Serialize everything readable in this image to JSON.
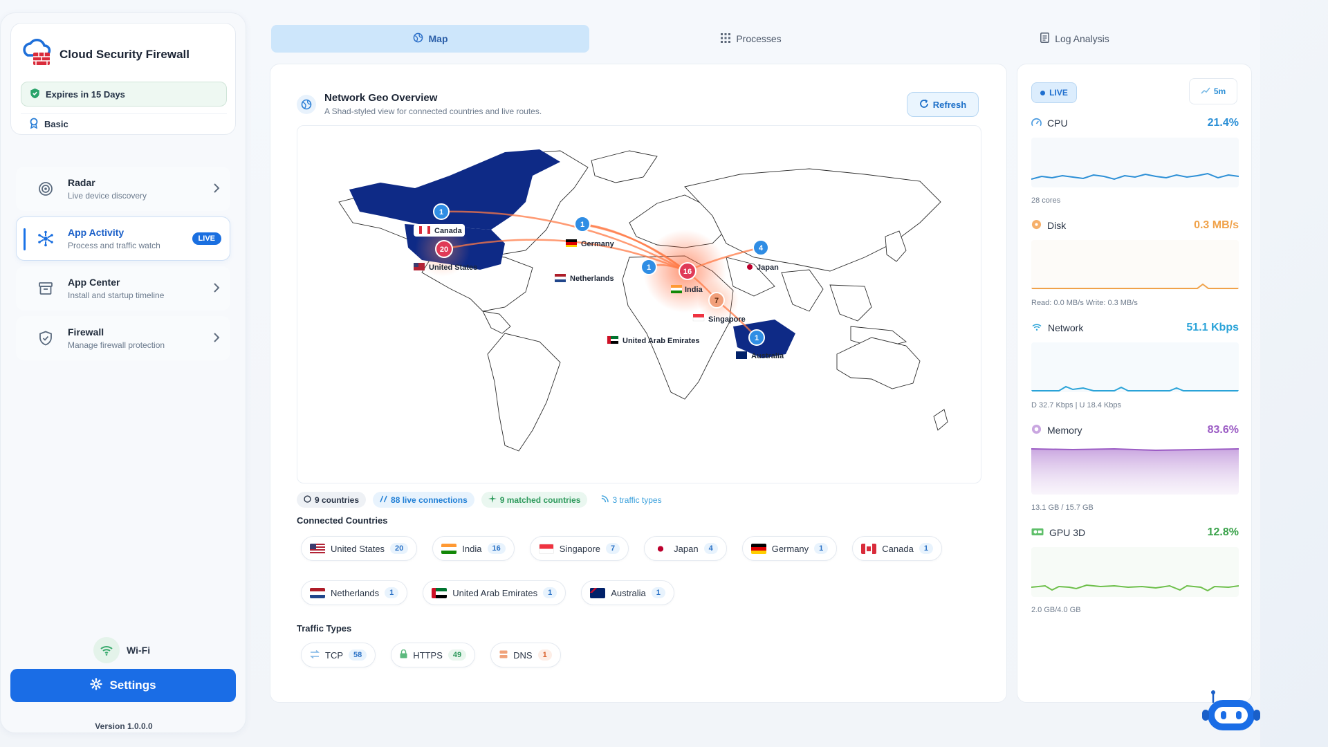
{
  "brand": {
    "title": "Cloud Security Firewall",
    "expires": "Expires in 15 Days",
    "plan": "Basic"
  },
  "nav": [
    {
      "title": "Radar",
      "sub": "Live device discovery"
    },
    {
      "title": "App Activity",
      "sub": "Process and traffic watch",
      "badge": "LIVE"
    },
    {
      "title": "App Center",
      "sub": "Install and startup timeline"
    },
    {
      "title": "Firewall",
      "sub": "Manage firewall protection"
    }
  ],
  "wifi": "Wi-Fi",
  "settings": "Settings",
  "version": "Version 1.0.0.0",
  "tabs": [
    "Map",
    "Processes",
    "Log Analysis"
  ],
  "map_panel": {
    "title": "Network Geo Overview",
    "subtitle": "A Shad-styled view for connected countries and live routes.",
    "refresh": "Refresh",
    "markers": [
      {
        "label": "Canada",
        "count": "1"
      },
      {
        "label": "United States",
        "count": "20"
      },
      {
        "label": "Germany",
        "count": "1"
      },
      {
        "label": "Netherlands",
        "count": "1"
      },
      {
        "label": "India",
        "count": "16"
      },
      {
        "label": "Japan",
        "count": "4"
      },
      {
        "label": "Singapore",
        "count": "7"
      },
      {
        "label": "United Arab Emirates",
        "count": "1"
      },
      {
        "label": "Australia",
        "count": "1"
      }
    ],
    "stats": {
      "countries": "9 countries",
      "connections": "88 live connections",
      "matched": "9 matched countries",
      "types": "3 traffic types"
    },
    "connected_label": "Connected Countries",
    "countries": [
      {
        "name": "United States",
        "count": "20"
      },
      {
        "name": "India",
        "count": "16"
      },
      {
        "name": "Singapore",
        "count": "7"
      },
      {
        "name": "Japan",
        "count": "4"
      },
      {
        "name": "Germany",
        "count": "1"
      },
      {
        "name": "Canada",
        "count": "1"
      },
      {
        "name": "Netherlands",
        "count": "1"
      },
      {
        "name": "United Arab Emirates",
        "count": "1"
      },
      {
        "name": "Australia",
        "count": "1"
      }
    ],
    "traffic_label": "Traffic Types",
    "traffic": [
      {
        "name": "TCP",
        "count": "58"
      },
      {
        "name": "HTTPS",
        "count": "49"
      },
      {
        "name": "DNS",
        "count": "1"
      }
    ]
  },
  "right_panel": {
    "live": "LIVE",
    "range": "5m",
    "cpu": {
      "name": "CPU",
      "value": "21.4%",
      "foot": "28 cores",
      "color": "#2b8fd6"
    },
    "disk": {
      "name": "Disk",
      "value": "0.3 MB/s",
      "foot": "Read: 0.0 MB/s  Write: 0.3 MB/s",
      "color": "#f0a24a"
    },
    "network": {
      "name": "Network",
      "value": "51.1 Kbps",
      "foot": "D 32.7 Kbps | U 18.4 Kbps",
      "color": "#2aa3d8"
    },
    "memory": {
      "name": "Memory",
      "value": "83.6%",
      "foot": "13.1 GB / 15.7 GB",
      "color": "#9b5bc4"
    },
    "gpu": {
      "name": "GPU 3D",
      "value": "12.8%",
      "foot": "2.0 GB/4.0 GB",
      "color": "#4caf50"
    }
  }
}
